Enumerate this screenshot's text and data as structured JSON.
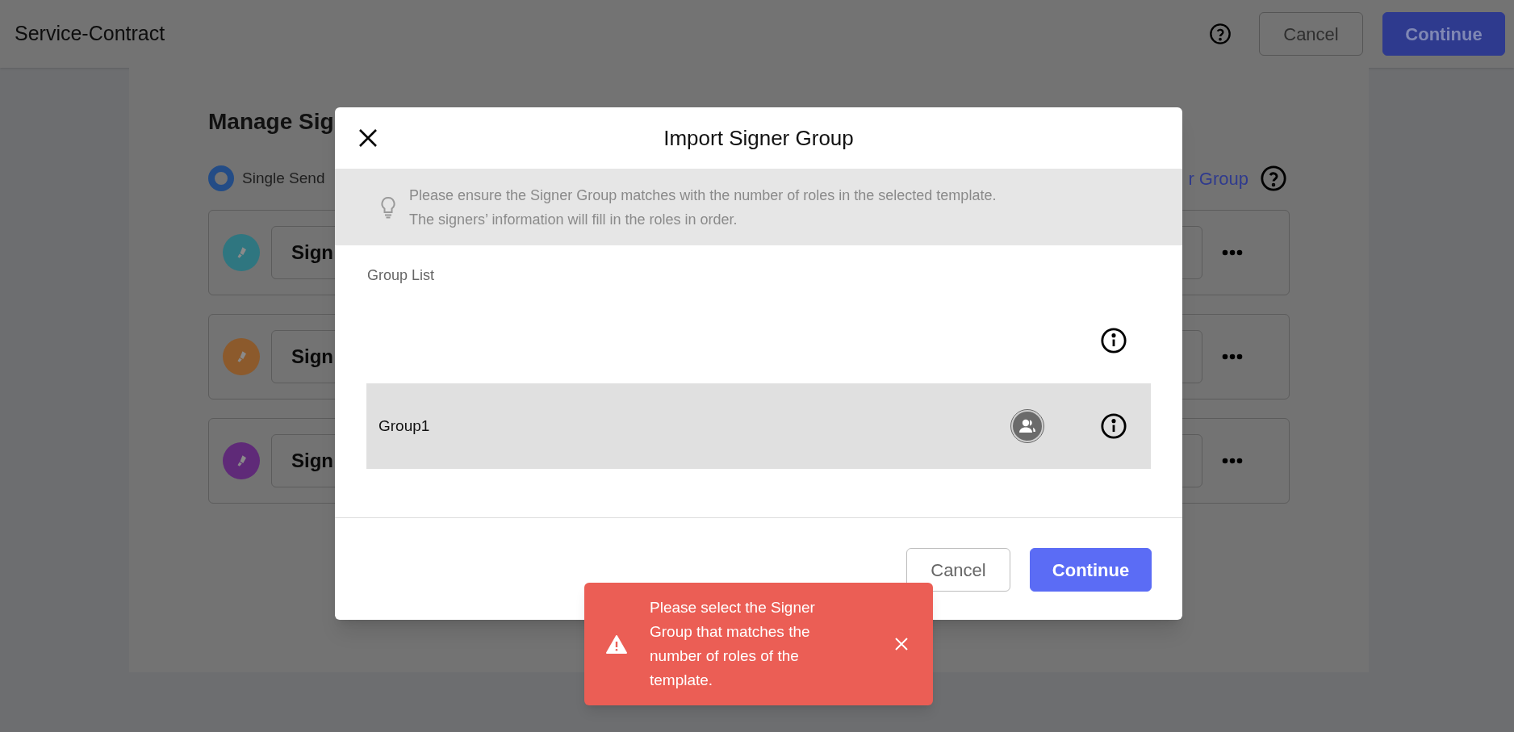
{
  "header": {
    "title": "Service-Contract",
    "buttons": [
      {
        "label": "Cancel",
        "kind": "secondary"
      },
      {
        "label": "Continue",
        "kind": "primary"
      }
    ]
  },
  "page": {
    "heading": "Manage Sig",
    "mode": {
      "label": "Single Send",
      "selected": true
    },
    "import_link": "r Group",
    "signers": [
      {
        "label": "Sign",
        "color": "#2f7680"
      },
      {
        "label": "Sign",
        "color": "#8c5a2c"
      },
      {
        "label": "Sign",
        "color": "#5f2a78"
      }
    ]
  },
  "dialog": {
    "title": "Import Signer Group",
    "tip": [
      "Please ensure the Signer Group matches with the number of roles in the selected template.",
      "The signers’ information will fill in the roles in order."
    ],
    "list_label": "Group List",
    "groups": [
      {
        "highlighted": false,
        "members_icon": false
      },
      {
        "name": "Group1",
        "highlighted": true,
        "members_icon": true
      }
    ],
    "buttons": [
      {
        "label": "Cancel",
        "kind": "secondary"
      },
      {
        "label": "Continue",
        "kind": "primary"
      }
    ]
  },
  "toast": {
    "message": "Please select the Signer Group that matches the number of roles of the template."
  }
}
